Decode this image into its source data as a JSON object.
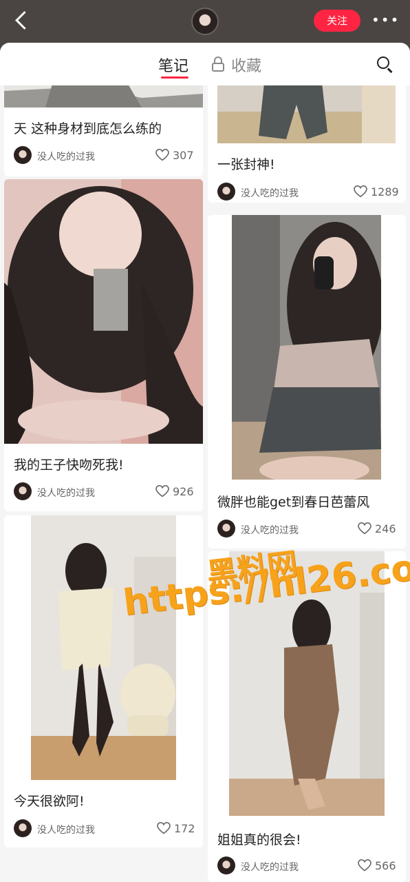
{
  "header": {
    "follow_label": "关注",
    "more_label": "•••"
  },
  "tabs": {
    "notes": "笔记",
    "favorites": "收藏"
  },
  "notes": [
    {
      "title": "天 这种身材到底怎么练的",
      "author": "没人吃的过我",
      "likes": "307"
    },
    {
      "title": "一张封神!",
      "author": "没人吃的过我",
      "likes": "1289"
    },
    {
      "title": "我的王子快吻死我!",
      "author": "没人吃的过我",
      "likes": "926"
    },
    {
      "title": "微胖也能get到春日芭蕾风",
      "author": "没人吃的过我",
      "likes": "246"
    },
    {
      "title": "今天很欲阿!",
      "author": "没人吃的过我",
      "likes": "172"
    },
    {
      "title": "姐姐真的很会!",
      "author": "没人吃的过我",
      "likes": "566"
    }
  ],
  "watermark": {
    "line1": "黑料网",
    "line2": "https://hl26.co"
  },
  "colors": {
    "accent": "#ff2442",
    "header_bg": "#4a4542",
    "watermark": "#f7a21b"
  }
}
